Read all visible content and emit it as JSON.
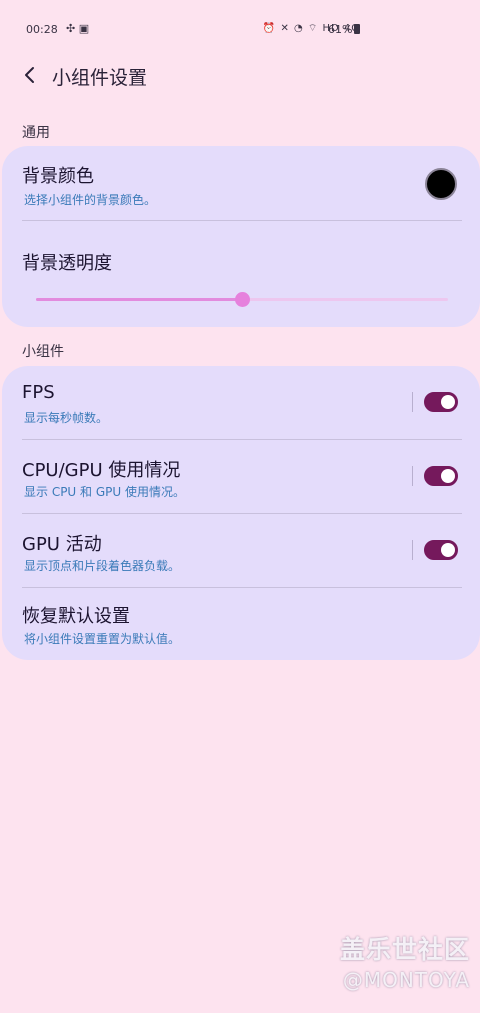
{
  "status_bar": {
    "time": "00:28",
    "left_icons": "✣ ▣",
    "right_icons": "⏰ ✕ ◔ ⌔ HD 4G",
    "battery": "61%"
  },
  "header": {
    "title": "小组件设置"
  },
  "sections": {
    "general": "通用",
    "widgets": "小组件"
  },
  "general": {
    "bg_color": {
      "title": "背景颜色",
      "subtitle": "选择小组件的背景颜色。",
      "color": "#000000"
    },
    "bg_opacity": {
      "title": "背景透明度",
      "value": 0.5
    }
  },
  "widgets": {
    "fps": {
      "title": "FPS",
      "subtitle": "显示每秒帧数。",
      "on": true
    },
    "cpu_gpu": {
      "title": "CPU/GPU 使用情况",
      "subtitle": "显示 CPU 和 GPU 使用情况。",
      "on": true
    },
    "gpu_activity": {
      "title": "GPU 活动",
      "subtitle": "显示顶点和片段着色器负载。",
      "on": true
    },
    "reset": {
      "title": "恢复默认设置",
      "subtitle": "将小组件设置重置为默认值。"
    }
  },
  "watermark": {
    "cn": "盖乐世社区",
    "en": "@MONTOYA"
  }
}
